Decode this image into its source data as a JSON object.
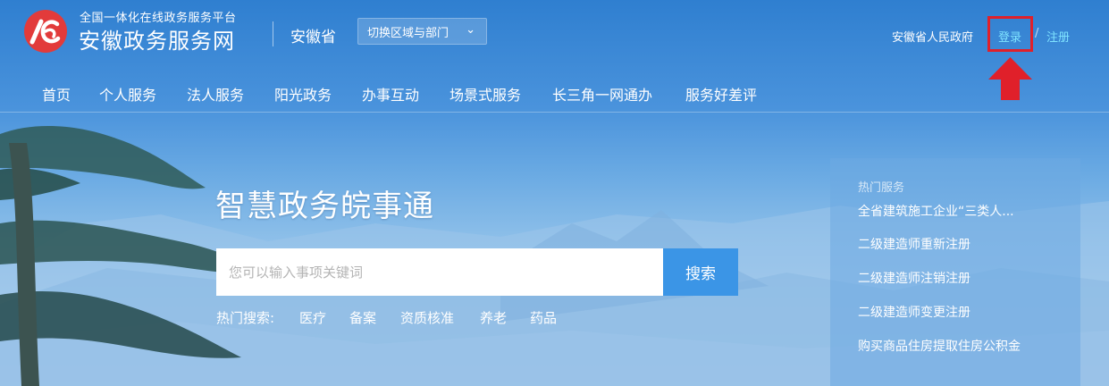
{
  "header": {
    "logo_subtitle": "全国一体化在线政务服务平台",
    "logo_title": "安徽政务服务网",
    "province": "安徽省",
    "region_button": "切换区域与部门",
    "gov_link": "安徽省人民政府",
    "login": "登录",
    "separator": "/",
    "register": "注册"
  },
  "nav": {
    "items": [
      "首页",
      "个人服务",
      "法人服务",
      "阳光政务",
      "办事互动",
      "场景式服务",
      "长三角一网通办",
      "服务好差评"
    ]
  },
  "hero": {
    "title": "智慧政务皖事通",
    "search_placeholder": "您可以输入事项关键词",
    "search_button": "搜索",
    "hot_label": "热门搜索:",
    "hot_tags": [
      "医疗",
      "备案",
      "资质核准",
      "养老",
      "药品"
    ]
  },
  "panel": {
    "title": "热门服务",
    "items": [
      "全省建筑施工企业“三类人...",
      "二级建造师重新注册",
      "二级建造师注销注册",
      "二级建造师变更注册",
      "购买商品住房提取住房公积金"
    ]
  },
  "colors": {
    "header_blue": "#2f7fd0",
    "logo_red": "#e23b3b",
    "highlight_red": "#e0202a",
    "link_cyan": "#7fe3ff",
    "search_button_blue": "#3b95e6"
  },
  "icons": {
    "logo": "anhui-logo-icon",
    "dropdown": "chevron-down-icon",
    "annotation": "arrow-up-icon"
  }
}
